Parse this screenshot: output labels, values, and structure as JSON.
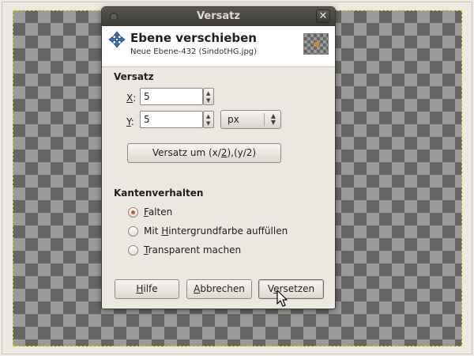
{
  "dialog": {
    "title": "Versatz",
    "close_glyph": "✕",
    "header_title": "Ebene verschieben",
    "header_subtitle": "Neue Ebene-432 (SindotHG.jpg)"
  },
  "offset": {
    "section_label": "Versatz",
    "x_label_mnemonic": "X",
    "x_label_rest": ":",
    "x_value": "5",
    "y_label_mnemonic": "Y",
    "y_label_rest": ":",
    "y_value": "5",
    "unit_selected": "px",
    "half_button_pre": "Versatz um (x/",
    "half_button_mnemonic": "2",
    "half_button_post": "),(y/2)"
  },
  "edge": {
    "section_label": "Kantenverhalten",
    "options": [
      {
        "mnemonic": "F",
        "rest": "alten",
        "checked": true
      },
      {
        "pre": "Mit ",
        "mnemonic": "H",
        "rest": "intergrundfarbe auffüllen",
        "checked": false
      },
      {
        "mnemonic": "T",
        "rest": "ransparent machen",
        "checked": false
      }
    ]
  },
  "buttons": {
    "help_mnemonic": "H",
    "help_rest": "ilfe",
    "cancel_mnemonic": "A",
    "cancel_rest": "bbrechen",
    "apply_pre": "V",
    "apply_mnemonic": "e",
    "apply_rest": "rsetzen"
  },
  "colors": {
    "titlebar": "#3c3b37",
    "dialog_bg": "#ece7e1",
    "radio_accent": "#d0591f",
    "selection_dash": "#e6d400"
  },
  "icons": {
    "move": "move-arrows-icon",
    "close": "close-icon",
    "window_menu": "window-menu-icon",
    "cursor": "mouse-pointer-icon"
  }
}
